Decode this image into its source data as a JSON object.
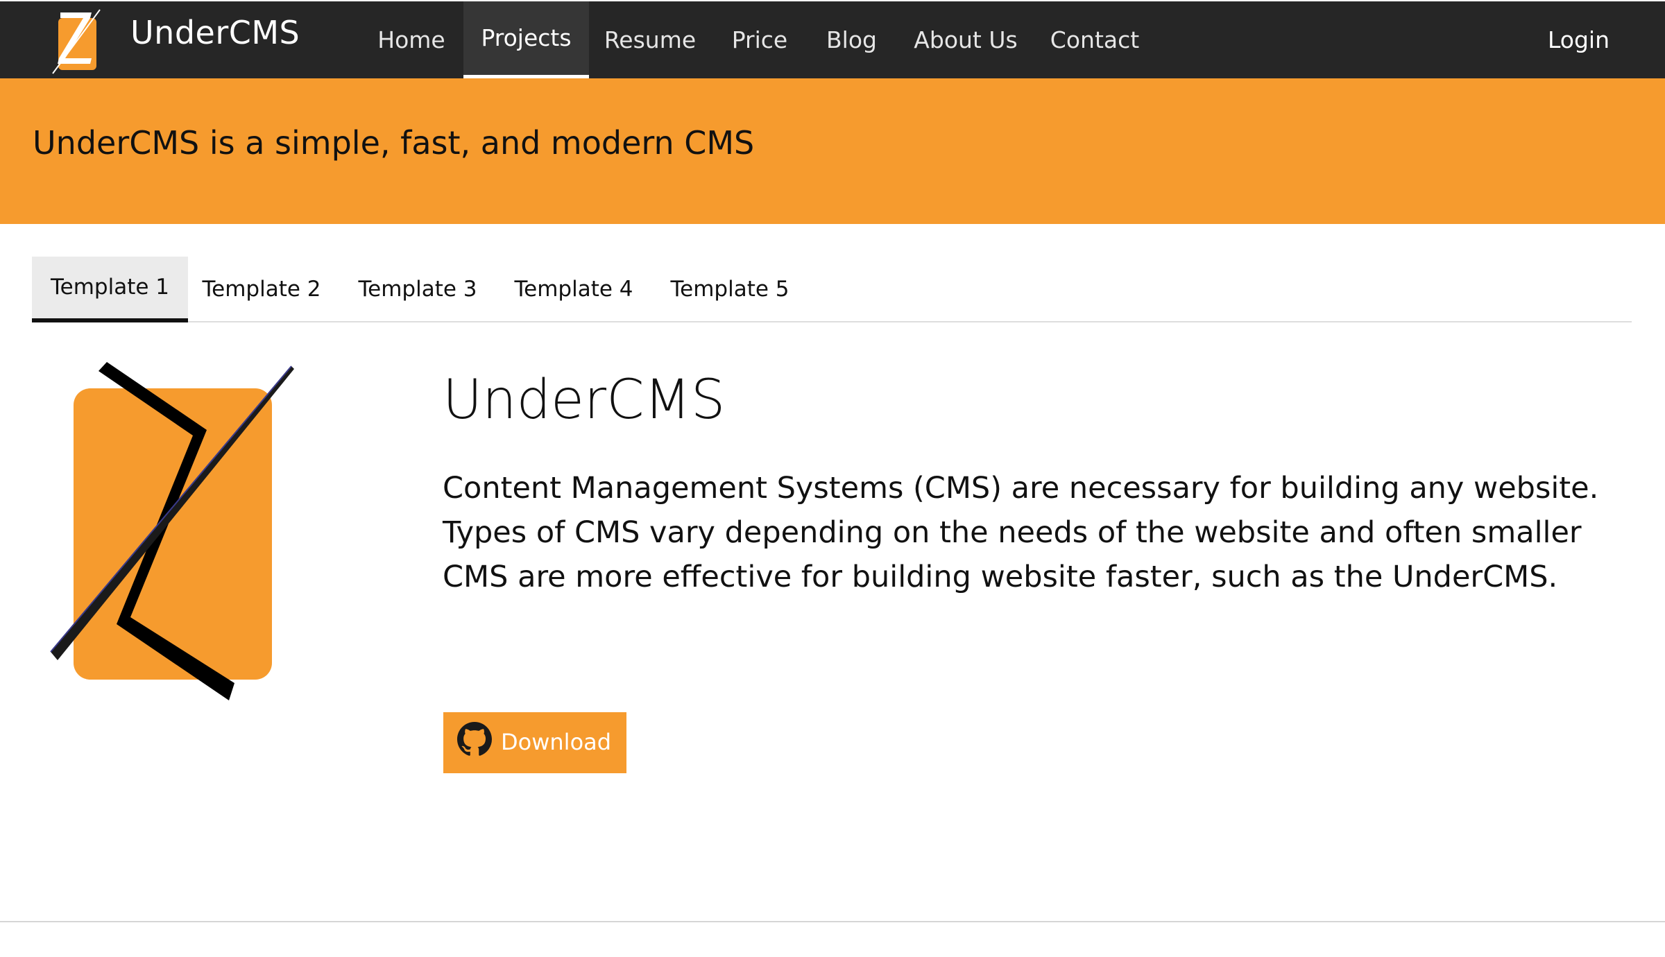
{
  "brand": {
    "name": "UnderCMS",
    "logo_icon": "undercms-logo-icon"
  },
  "nav": {
    "items": [
      {
        "label": "Home"
      },
      {
        "label": "Projects",
        "active": true
      },
      {
        "label": "Resume"
      },
      {
        "label": "Price"
      },
      {
        "label": "Blog"
      },
      {
        "label": "About Us"
      },
      {
        "label": "Contact"
      }
    ],
    "login_label": "Login"
  },
  "banner": {
    "text": "UnderCMS is a simple, fast, and modern CMS"
  },
  "tabs": [
    {
      "label": "Template 1",
      "active": true
    },
    {
      "label": "Template 2"
    },
    {
      "label": "Template 3"
    },
    {
      "label": "Template 4"
    },
    {
      "label": "Template 5"
    }
  ],
  "content": {
    "title": "UnderCMS",
    "description": "Content Management Systems (CMS) are necessary for building any website. Types of CMS vary depending on the needs of the website and often smaller CMS are more effective for building website faster, such as the UnderCMS.",
    "download_label": "Download",
    "download_icon": "github-icon"
  },
  "colors": {
    "accent": "#f69b2e",
    "navbar": "#262626",
    "nav_active": "#363636"
  }
}
